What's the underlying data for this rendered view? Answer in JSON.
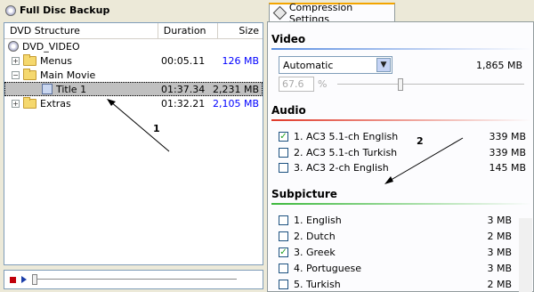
{
  "left": {
    "title": "Full Disc Backup",
    "columns": [
      "DVD Structure",
      "Duration",
      "Size"
    ],
    "rows": [
      {
        "name": "DVD_VIDEO",
        "duration": "",
        "size": ""
      },
      {
        "name": "Menus",
        "duration": "00:05.11",
        "size": "126 MB"
      },
      {
        "name": "Main Movie",
        "duration": "",
        "size": ""
      },
      {
        "name": "Title 1",
        "duration": "01:37.34",
        "size": "2,231 MB"
      },
      {
        "name": "Extras",
        "duration": "01:32.21",
        "size": "2,105 MB"
      }
    ],
    "annotation": "1"
  },
  "right": {
    "tab_label": "Compression Settings",
    "video": {
      "title": "Video",
      "mode": "Automatic",
      "size": "1,865 MB",
      "percent_value": "67.6",
      "percent_unit": "%"
    },
    "audio": {
      "title": "Audio",
      "items": [
        {
          "label": "1. AC3 5.1-ch English",
          "size": "339 MB",
          "checked": "✓"
        },
        {
          "label": "2. AC3 5.1-ch Turkish",
          "size": "339 MB",
          "checked": ""
        },
        {
          "label": "3. AC3 2-ch English",
          "size": "145 MB",
          "checked": ""
        }
      ]
    },
    "subpicture": {
      "title": "Subpicture",
      "items": [
        {
          "label": "1. English",
          "size": "3 MB",
          "checked": ""
        },
        {
          "label": "2. Dutch",
          "size": "2 MB",
          "checked": ""
        },
        {
          "label": "3. Greek",
          "size": "3 MB",
          "checked": "✓"
        },
        {
          "label": "4. Portuguese",
          "size": "3 MB",
          "checked": ""
        },
        {
          "label": "5. Turkish",
          "size": "2 MB",
          "checked": ""
        }
      ]
    },
    "annotation": "2"
  },
  "colors": {
    "video_line": "#5a8de0",
    "audio_line": "#e03a2a",
    "subpicture_line": "#3cb83c",
    "size_blue": "#0000ff",
    "tab_accent": "#f3a500"
  },
  "icons": [
    "disc-icon",
    "folder-icon",
    "film-icon",
    "stop-icon",
    "play-icon",
    "compression-icon",
    "dropdown-arrow-icon"
  ]
}
